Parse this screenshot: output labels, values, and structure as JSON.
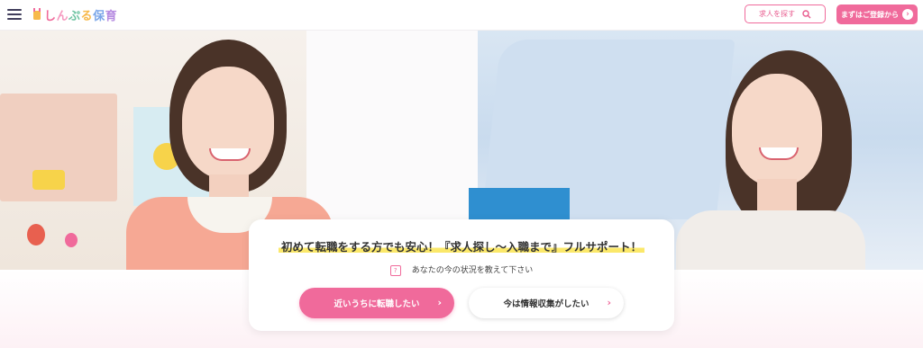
{
  "header": {
    "logo_text": [
      "し",
      "ん",
      "ぷ",
      "る",
      "保",
      "育"
    ],
    "search_button_label": "求人を探す",
    "register_button_label": "まずはご登録から"
  },
  "hero": {
    "card": {
      "headline": "初めて転職をする方でも安心！『求人探し〜入職まで』フルサポート！",
      "subtext": "あなたの今の状況を教えて下さい",
      "primary_button": "近いうちに転職したい",
      "secondary_button": "今は情報収集がしたい"
    }
  },
  "colors": {
    "accent": "#f06a9b",
    "highlight": "#fbe86a"
  },
  "icons": [
    "menu-icon",
    "search-icon",
    "arrow-right-icon",
    "question-icon",
    "chevron-right-icon"
  ]
}
